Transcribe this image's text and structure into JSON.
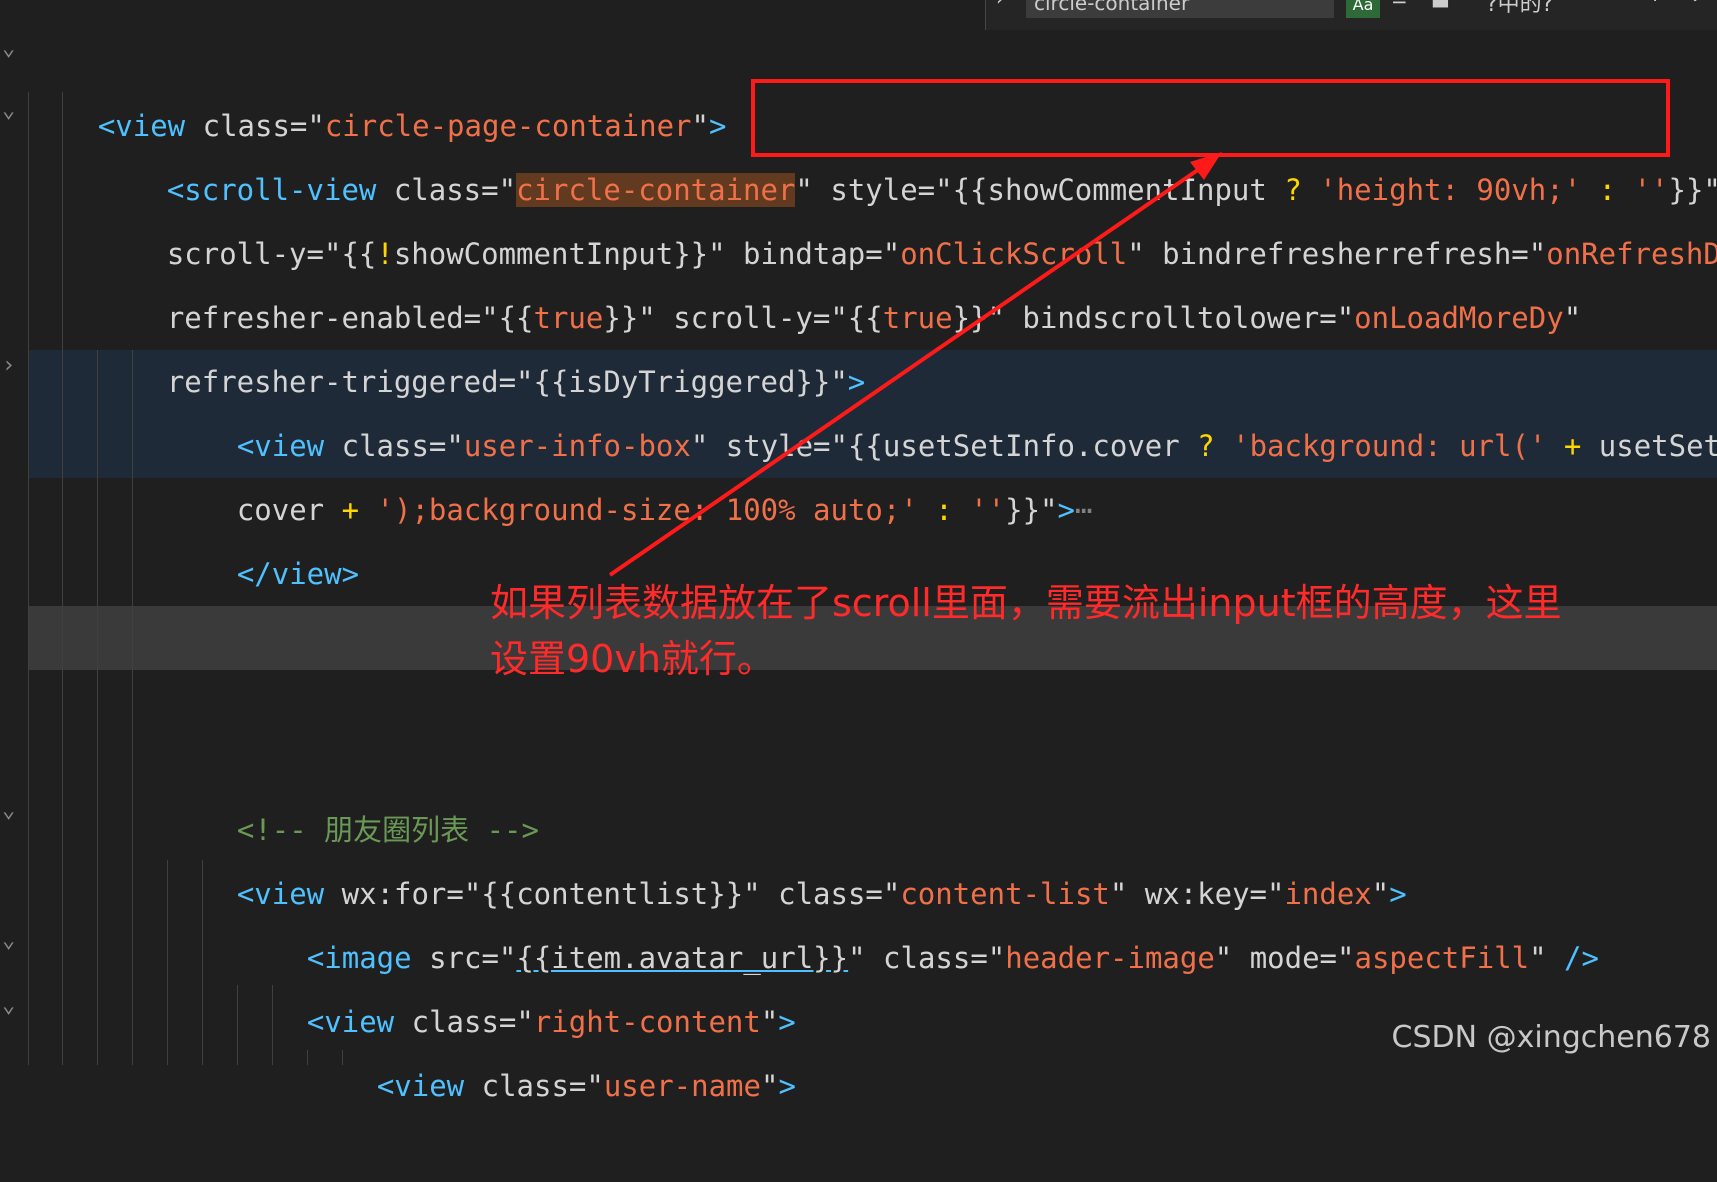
{
  "find_widget": {
    "query": "circle-container",
    "option_label": "Aa",
    "result_count": "?中的?",
    "arrow_up": "↑",
    "arrow_down": "↓"
  },
  "code": {
    "line1": {
      "open": "<view ",
      "attr": "class=",
      "q1": "\"",
      "val": "circle-page-container",
      "q2": "\"",
      "close": ">"
    },
    "line2": {
      "open": "<scroll-view ",
      "attr": "class=",
      "q1": "\"",
      "val": "circle-container",
      "q2": "\"",
      "sp": " ",
      "attr2": "style=",
      "q3": "\"{{showCommentInput ",
      "op": "?",
      "sp2": " ",
      "val2": "'height: 90vh;'",
      "sp3": " ",
      "op2": ":",
      "sp4": " ",
      "val3": "''",
      "end": "}}\""
    },
    "line3": {
      "a1": "scroll-y=",
      "q1": "\"{{",
      "op": "!",
      "t": "showCommentInput}}\" ",
      "a2": "bindtap=",
      "q2": "\"",
      "v2": "onClickScroll",
      "q3": "\" ",
      "a3": "bindrefresherrefresh=",
      "q4": "\"",
      "v3": "onRefreshDy",
      "q5": "\""
    },
    "line4": {
      "a1": "refresher-enabled=",
      "q1": "\"{{",
      "v1": "true",
      "q2": "}}\" ",
      "a2": "scroll-y=",
      "q3": "\"{{",
      "v2": "true",
      "q4": "}}\" ",
      "a3": "bindscrolltolower=",
      "q5": "\"",
      "v3": "onLoadMoreDy",
      "q6": "\""
    },
    "line5": {
      "a1": "refresher-triggered=",
      "q1": "\"{{isDyTriggered}}\"",
      "close": ">"
    },
    "line6": {
      "open": "<view ",
      "a1": "class=",
      "q1": "\"",
      "v1": "user-info-box",
      "q2": "\" ",
      "a2": "style=",
      "q3": "\"{{usetSetInfo.cover ",
      "op": "?",
      "sp": " ",
      "v2": "'background: url('",
      "sp2": " ",
      "op2": "+",
      "t": " usetSetInf"
    },
    "line7": {
      "t1": "cover ",
      "op": "+",
      "sp": " ",
      "v1": "');background-size: 100% auto;'",
      "sp2": " ",
      "op2": ":",
      "sp3": " ",
      "v2": "''",
      "t2": "}}\"",
      "close": ">",
      "ell": "⋯"
    },
    "line8": {
      "close": "</view>"
    },
    "line11": {
      "comment": "<!-- 朋友圈列表 -->"
    },
    "line12": {
      "open": "<view ",
      "a1": "wx:for=",
      "q1": "\"{{contentlist}}\" ",
      "a2": "class=",
      "q2": "\"",
      "v2": "content-list",
      "q3": "\" ",
      "a3": "wx:key=",
      "q4": "\"",
      "v3": "index",
      "q5": "\"",
      "close": ">"
    },
    "line13": {
      "open": "<image ",
      "a1": "src=",
      "q1": "\"",
      "u": "{{item.avatar_url}}",
      "q2": "\" ",
      "a2": "class=",
      "q3": "\"",
      "v2": "header-image",
      "q4": "\" ",
      "a3": "mode=",
      "q5": "\"",
      "v3": "aspectFill",
      "q6": "\" ",
      "close": "/>"
    },
    "line14": {
      "open": "<view ",
      "a1": "class=",
      "q1": "\"",
      "v1": "right-content",
      "q2": "\"",
      "close": ">"
    },
    "line15": {
      "open": "<view ",
      "a1": "class=",
      "q1": "\"",
      "v1": "user-name",
      "q2": "\"",
      "close": ">"
    }
  },
  "annotation": {
    "text_line1": "如果列表数据放在了scroll里面，需要流出input框的高度，这里",
    "text_line2": "设置90vh就行。"
  },
  "watermark": "CSDN @xingchen678",
  "colors": {
    "tag": "#4fc1ff",
    "string": "#f0704a",
    "operator": "#ffd700",
    "comment": "#6a9955",
    "annotation": "#ff2a2a"
  }
}
